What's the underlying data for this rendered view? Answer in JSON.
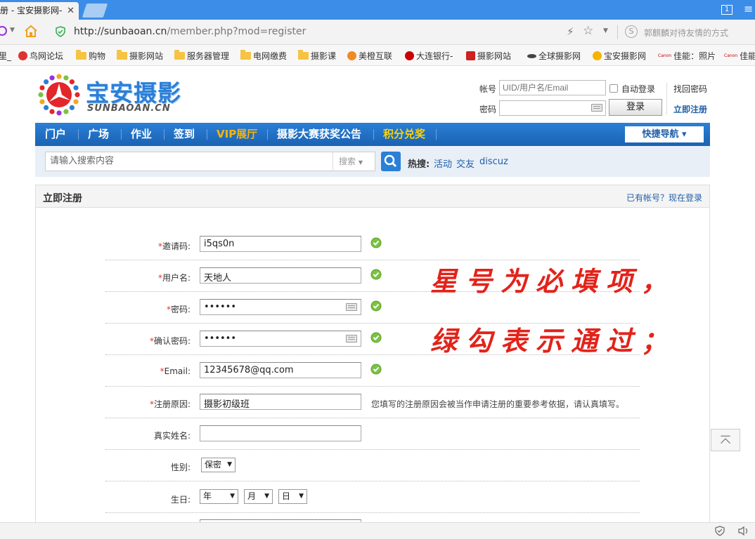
{
  "browser": {
    "tab_title": "册 - 宝安摄影网-",
    "tab_close": "✕",
    "win_box_label": "1",
    "url_host": "http://sunbaoan.cn",
    "url_path": "/member.php?mod=register",
    "addr_hint_icon": "S",
    "addr_hint": "郭麒麟对待友情的方式",
    "bookmarks": [
      "里_",
      "鸟网论坛",
      "购物",
      "摄影网站",
      "服务器管理",
      "电网缴费",
      "摄影课",
      "美橙互联",
      "大连银行-",
      "摄影网站",
      "全球摄影网",
      "宝安摄影网",
      "佳能：照片",
      "佳能"
    ]
  },
  "site": {
    "logo_text": "宝安摄影",
    "logo_sub": "SUNBAOAN.CN",
    "login": {
      "account_label": "帐号",
      "account_placeholder": "UID/用户名/Email",
      "auto_login": "自动登录",
      "find_password": "找回密码",
      "password_label": "密码",
      "login_button": "登录",
      "register_link": "立即注册"
    },
    "nav": {
      "items": [
        "门户",
        "广场",
        "作业",
        "签到",
        "VIP展厅",
        "摄影大赛获奖公告",
        "积分兑奖"
      ],
      "quick_nav": "快捷导航 ▾"
    },
    "search": {
      "placeholder": "请输入搜索内容",
      "select": "搜索",
      "hot_label": "热搜:",
      "hot_links": [
        "活动",
        "交友",
        "discuz"
      ]
    }
  },
  "form": {
    "title": "立即注册",
    "login_link": "已有帐号？现在登录",
    "required_mark": "*",
    "fields": [
      {
        "label": "邀请码:",
        "value": "i5qs0n"
      },
      {
        "label": "用户名:",
        "value": "天地人"
      },
      {
        "label": "密码:",
        "value": "••••••"
      },
      {
        "label": "确认密码:",
        "value": "••••••"
      },
      {
        "label": "Email:",
        "value": "12345678@qq.com"
      },
      {
        "label": "注册原因:",
        "value": "摄影初级班"
      },
      {
        "label": "真实姓名:",
        "value": ""
      }
    ],
    "reason_note": "您填写的注册原因会被当作申请注册的重要参考依据，请认真填写。",
    "gender_label": "性别:",
    "gender_value": "保密",
    "birthday_label": "生日:",
    "year": "年",
    "month": "月",
    "day": "日",
    "select_arrow": "▼"
  },
  "annotation": {
    "line1": "星号为必填项，",
    "line2": "绿勾表示通过；"
  },
  "colors": {
    "brand_blue": "#2b7fd6",
    "required_red": "#e53030",
    "highlight_orange": "#ffb400",
    "annotation_red": "#e2231a"
  }
}
